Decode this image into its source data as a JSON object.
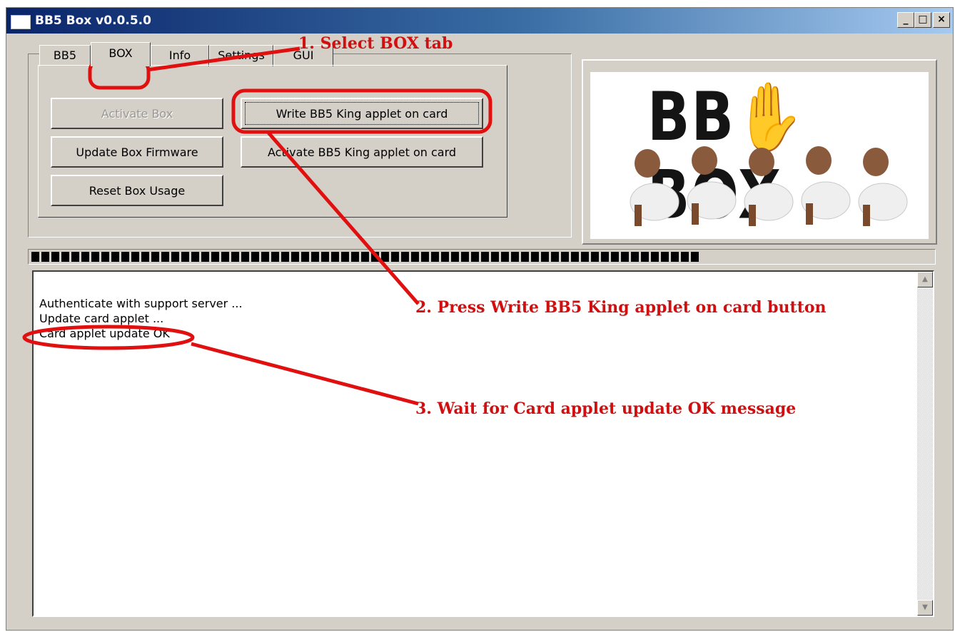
{
  "window": {
    "title": "BB5 Box v0.0.5.0"
  },
  "caption_buttons": {
    "minimize": "_",
    "maximize": "□",
    "close": "×"
  },
  "tabs": [
    {
      "label": "BB5",
      "active": false
    },
    {
      "label": "BOX",
      "active": true
    },
    {
      "label": "Info",
      "active": false
    },
    {
      "label": "Settings",
      "active": false
    },
    {
      "label": "GUI",
      "active": false
    }
  ],
  "box_tab": {
    "activate_box": "Activate Box",
    "update_firmware": "Update Box Firmware",
    "reset_usage": "Reset Box Usage",
    "write_applet": "Write BB5 King applet on card",
    "activate_applet": "Activate BB5 King applet on card"
  },
  "logo": {
    "text": "BB✋ BOX"
  },
  "progress": {
    "value_fraction": 0.74
  },
  "log": {
    "lines": [
      "Authenticate with support server ...",
      "Update card applet ...",
      "Card applet update OK"
    ]
  },
  "annotations": {
    "step1": "1. Select BOX tab",
    "step2": "2. Press Write BB5 King applet on card button",
    "step3": "3. Wait for Card applet update OK message"
  },
  "colors": {
    "annotation": "#d01010",
    "titlebar": "#0a246a",
    "face": "#d4d0c8"
  },
  "icons": {
    "minimize": "minimize-icon",
    "maximize": "maximize-icon",
    "close": "close-icon",
    "scroll_up": "arrow-up-icon",
    "scroll_down": "arrow-down-icon"
  }
}
